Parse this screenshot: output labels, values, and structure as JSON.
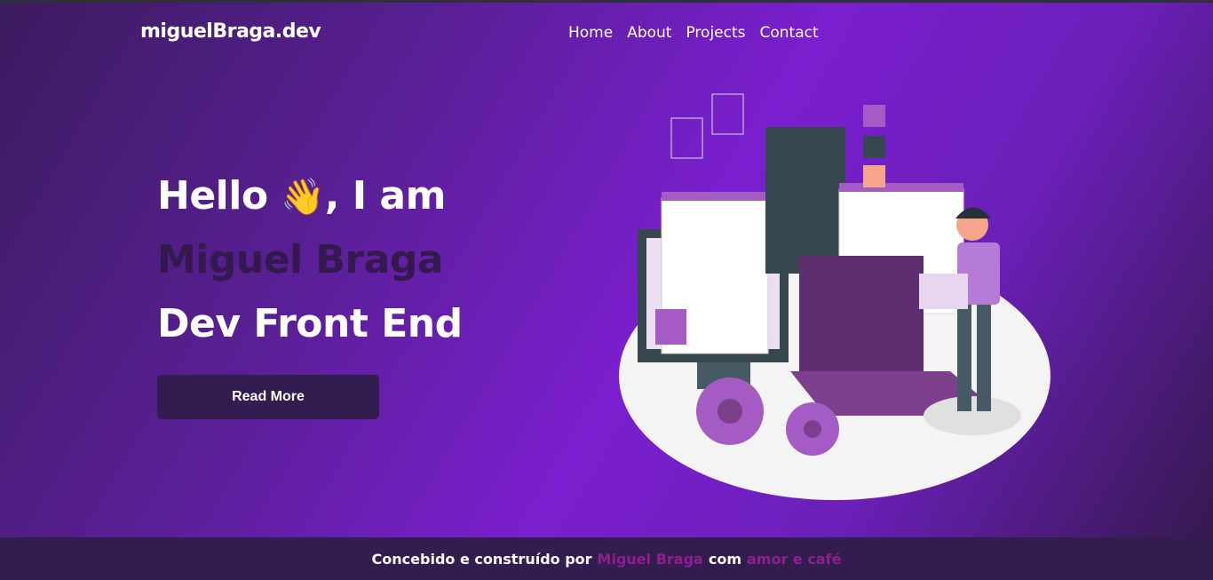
{
  "header": {
    "logo": "miguelBraga.dev",
    "nav": [
      "Home",
      "About",
      "Projects",
      "Contact"
    ]
  },
  "hero": {
    "greeting": "Hello",
    "wave": "👋",
    "greeting_end": ", I am",
    "name": "Miguel Braga",
    "role": "Dev Front End",
    "button": "Read More"
  },
  "footer": {
    "prefix": "Concebido e construído por",
    "author": "Miguel Braga",
    "middle": "com",
    "suffix": "amor e café"
  },
  "colors": {
    "accent": "#7a1fcf",
    "dark": "#331c4f",
    "footer_highlight": "#8e1f8e"
  }
}
